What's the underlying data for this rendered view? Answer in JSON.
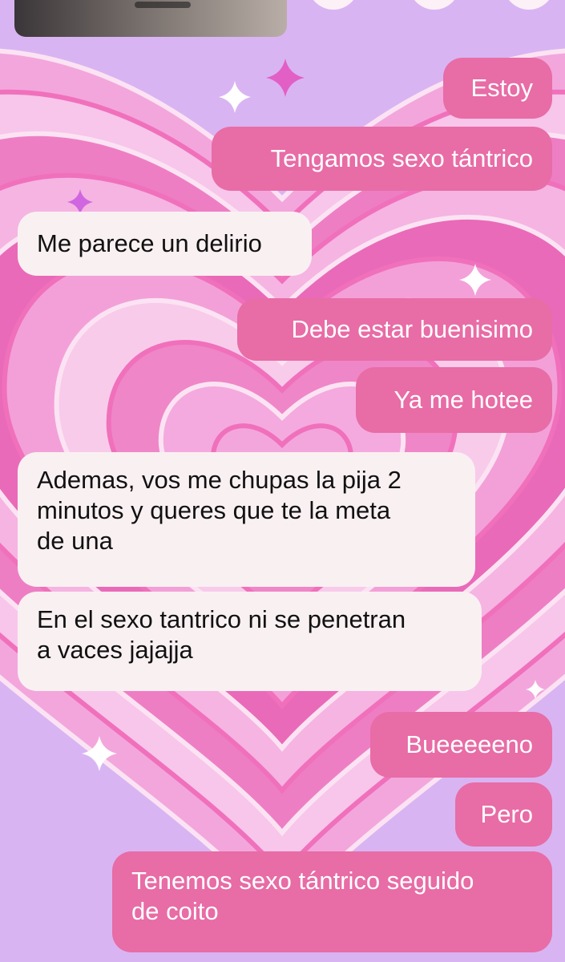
{
  "colors": {
    "outgoing_bubble": "#e86ca6",
    "incoming_bubble": "#f9f0f2",
    "wallpaper_base": "#d9b4f2",
    "heart_pink": "#f07fc4"
  },
  "wallpaper": {
    "theme": "pink concentric hearts with sparkles",
    "sparkle_icon": "sparkle-icon"
  },
  "messages": [
    {
      "direction": "outgoing",
      "text": "Estoy"
    },
    {
      "direction": "outgoing",
      "text": "Tengamos sexo tántrico"
    },
    {
      "direction": "incoming",
      "text": "Me parece un delirio"
    },
    {
      "direction": "outgoing",
      "text": "Debe estar buenisimo"
    },
    {
      "direction": "outgoing",
      "text": "Ya me hotee"
    },
    {
      "direction": "incoming",
      "text": "Ademas, vos me chupas la pija 2\nminutos y queres que te la meta\nde una"
    },
    {
      "direction": "incoming",
      "text": "En el sexo tantrico ni se penetran\na vaces jajajja"
    },
    {
      "direction": "outgoing",
      "text": "Bueeeeeno"
    },
    {
      "direction": "outgoing",
      "text": "Pero"
    },
    {
      "direction": "outgoing",
      "text": "Tenemos sexo tántrico seguido\nde coito"
    }
  ]
}
